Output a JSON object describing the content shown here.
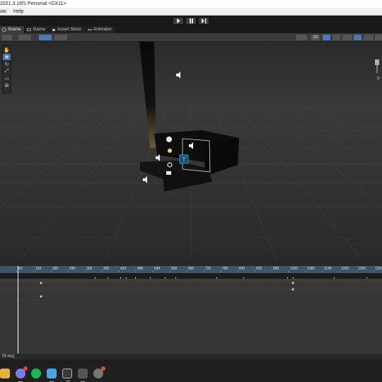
{
  "window": {
    "title": "2021.3.16f1 Personal <DX11>"
  },
  "menu": {
    "items": [
      "ow",
      "Help"
    ]
  },
  "toolbar": {
    "play_icon": "play-icon",
    "pause_icon": "pause-icon",
    "step_icon": "step-icon"
  },
  "tabs": [
    {
      "label": "Scene",
      "icon": "scene-icon"
    },
    {
      "label": "Game",
      "icon": "game-icon"
    },
    {
      "label": "Asset Store",
      "icon": "store-icon"
    },
    {
      "label": "Animator",
      "icon": "animator-icon"
    }
  ],
  "scene_toolbar": {
    "mode_2d": "2D",
    "persp_label": "P"
  },
  "timeline": {
    "ruler_labels": [
      "60",
      "120",
      "180",
      "240",
      "300",
      "360",
      "420",
      "480",
      "540",
      "600",
      "660",
      "720",
      "780",
      "840",
      "900",
      "960",
      "1020",
      "1080",
      "1140",
      "1200",
      "1260",
      "1320",
      "1380"
    ],
    "colors": {
      "ruler": "#3d5566",
      "playhead": "#ffffff",
      "keys": "#e8e8e8"
    }
  },
  "status": {
    "text": "79 ms)"
  },
  "taskbar": {
    "icons": [
      "file-explorer-icon",
      "discord-icon",
      "spotify-icon",
      "notepad-icon",
      "unity-icon",
      "unity-hub-icon",
      "chrome-icon"
    ]
  }
}
